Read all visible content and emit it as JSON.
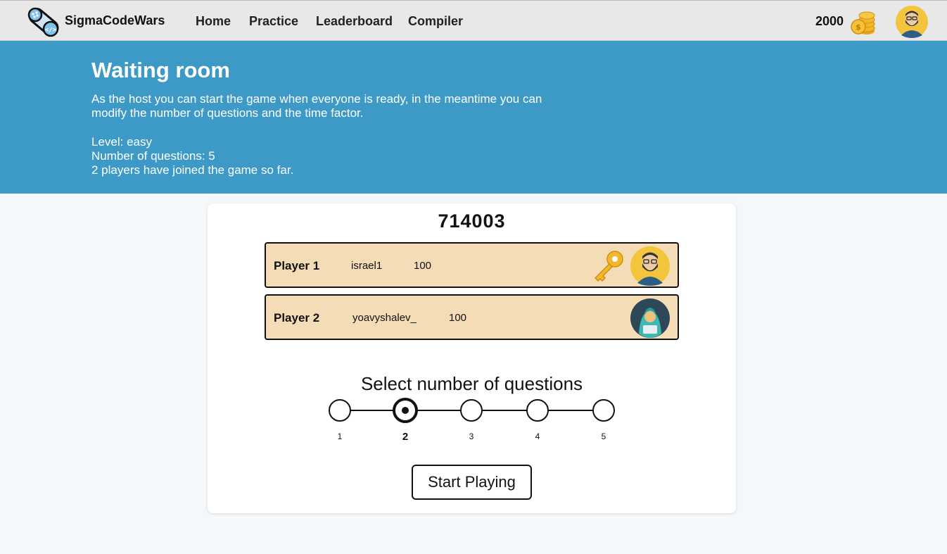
{
  "nav": {
    "brand": "SigmaCodeWars",
    "links": [
      "Home",
      "Practice",
      "Leaderboard",
      "Compiler"
    ],
    "coins": "2000"
  },
  "hero": {
    "title": "Waiting room",
    "description": "As the host you can start the game when everyone is ready, in the meantime you can modify the number of questions and the time factor.",
    "level": "Level: easy",
    "questions": "Number of questions: 5",
    "players_joined": "2 players have joined the game so far."
  },
  "game": {
    "code": "714003",
    "players": [
      {
        "label": "Player 1",
        "username": "israel1",
        "score": "100",
        "is_host": true,
        "avatar": "bearded-man-avatar"
      },
      {
        "label": "Player 2",
        "username": "yoavyshalev_",
        "score": "100",
        "is_host": false,
        "avatar": "hooded-coder-avatar"
      }
    ]
  },
  "selector": {
    "title": "Select number of questions",
    "options": [
      "1",
      "2",
      "3",
      "4",
      "5"
    ],
    "selected": "2"
  },
  "actions": {
    "start": "Start Playing"
  },
  "colors": {
    "hero_bg": "#3d9ac7",
    "player_row_bg": "#f4dcb6",
    "topbar_bg": "#e8e8e8"
  }
}
